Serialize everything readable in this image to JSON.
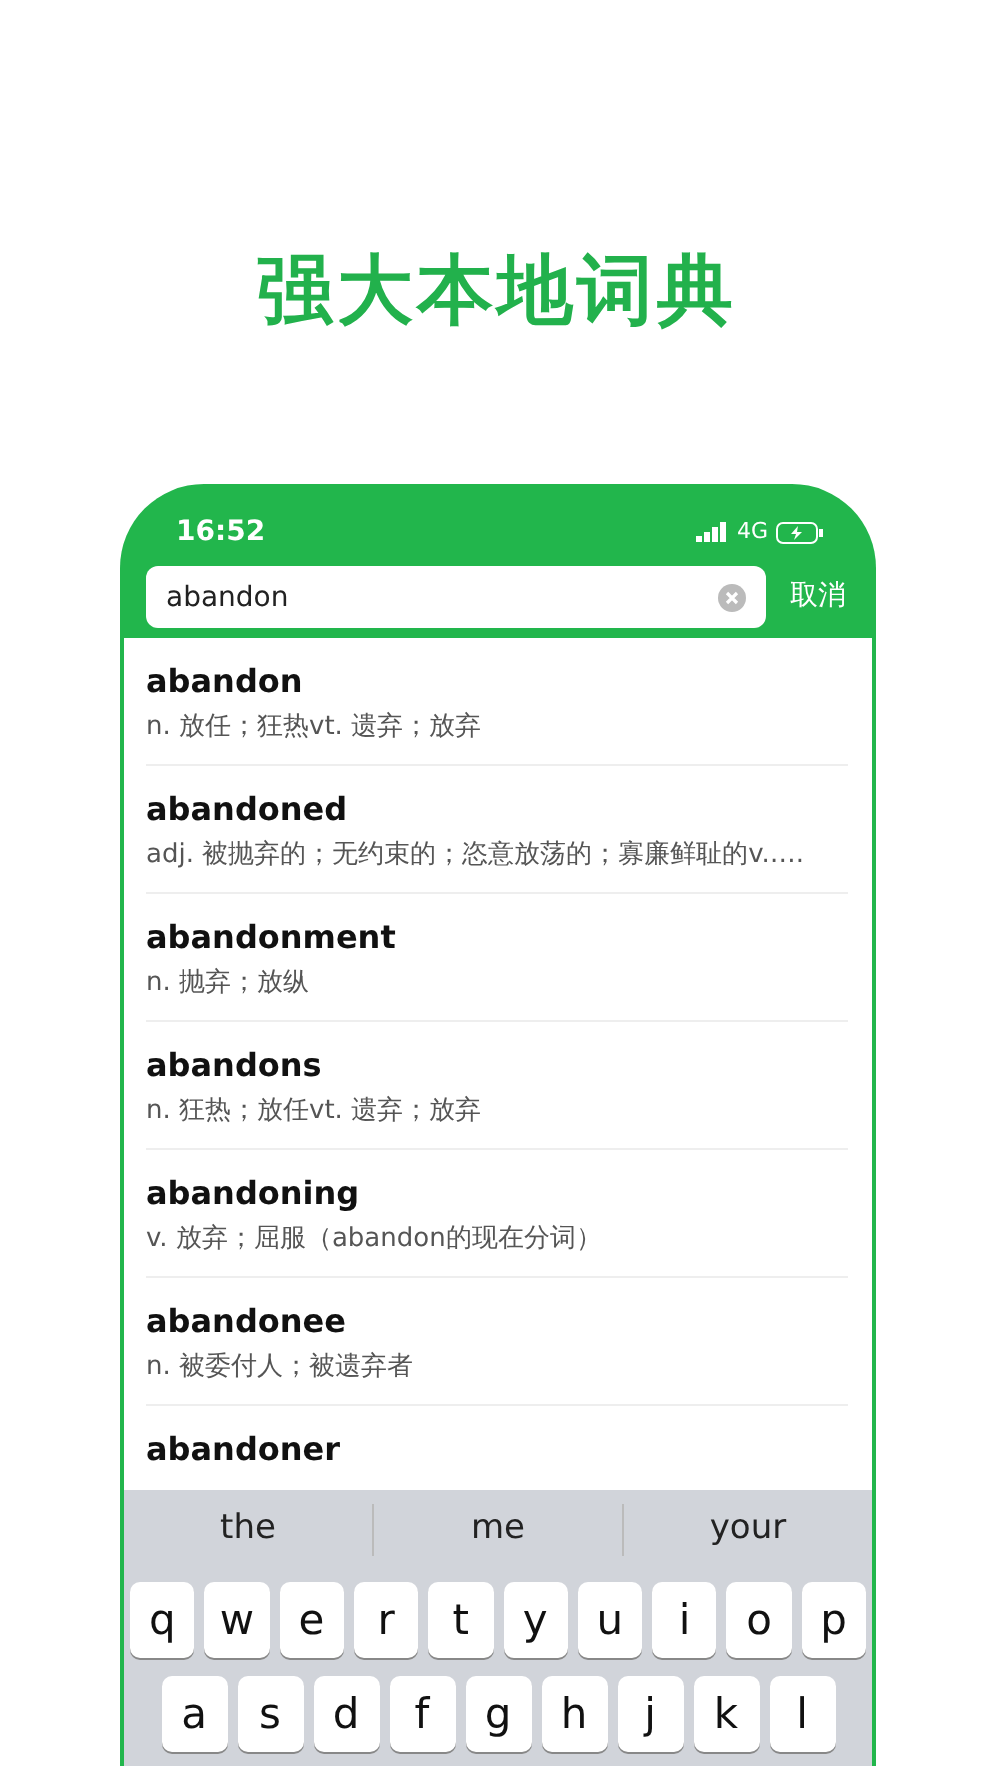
{
  "headline": "强大本地词典",
  "phone": {
    "status_time": "16:52",
    "network": "4G",
    "search": {
      "value": "abandon"
    },
    "cancel": "取消",
    "results": [
      {
        "word": "abandon",
        "definition": "n. 放任；狂热vt. 遗弃；放弃"
      },
      {
        "word": "abandoned",
        "definition": "adj. 被抛弃的；无约束的；恣意放荡的；寡廉鲜耻的v.…."
      },
      {
        "word": "abandonment",
        "definition": "n. 抛弃；放纵"
      },
      {
        "word": "abandons",
        "definition": "n. 狂热；放任vt. 遗弃；放弃"
      },
      {
        "word": "abandoning",
        "definition": "v. 放弃；屈服（abandon的现在分词）"
      },
      {
        "word": "abandonee",
        "definition": "n. 被委付人；被遗弃者"
      },
      {
        "word": "abandoner"
      }
    ],
    "keyboard": {
      "suggestions": [
        "the",
        "me",
        "your"
      ],
      "rows": [
        [
          "q",
          "w",
          "e",
          "r",
          "t",
          "y",
          "u",
          "i",
          "o",
          "p"
        ],
        [
          "a",
          "s",
          "d",
          "f",
          "g",
          "h",
          "j",
          "k",
          "l"
        ]
      ]
    }
  }
}
